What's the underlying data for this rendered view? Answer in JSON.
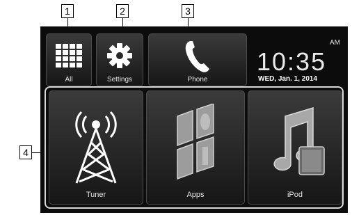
{
  "top_tiles": [
    {
      "label": "All",
      "icon": "grid-icon"
    },
    {
      "label": "Settings",
      "icon": "gear-icon"
    },
    {
      "label": "Phone",
      "icon": "phone-icon"
    }
  ],
  "clock": {
    "ampm": "AM",
    "time": "10:35",
    "date": "WED, Jan. 1, 2014"
  },
  "sources": [
    {
      "label": "Tuner",
      "icon": "antenna-tower-icon"
    },
    {
      "label": "Apps",
      "icon": "apps-icon"
    },
    {
      "label": "iPod",
      "icon": "music-note-icon"
    }
  ],
  "callouts": [
    "1",
    "2",
    "3",
    "4"
  ],
  "colors": {
    "background": "#0c0c0c",
    "tile_top": "#3b3b3b",
    "tile_bottom": "#161616",
    "text": "#e6e6e6"
  }
}
